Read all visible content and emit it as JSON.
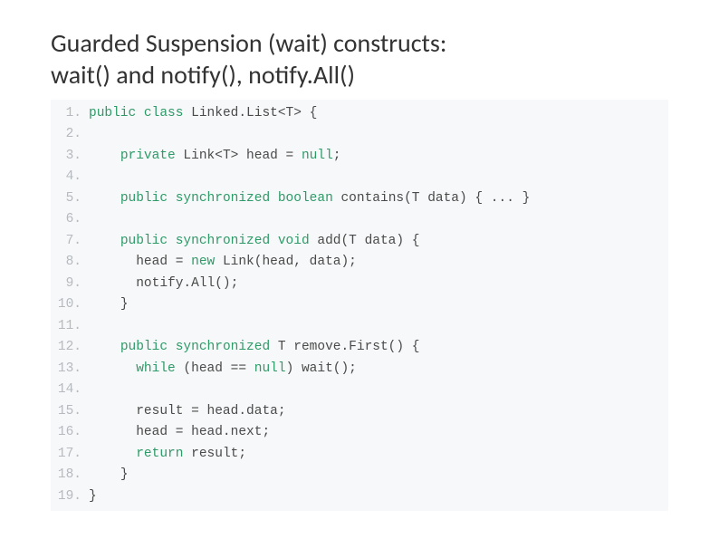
{
  "title_line1": "Guarded Suspension (wait) constructs:",
  "title_line2": "wait() and notify(), notify.All()",
  "code": {
    "lines": [
      {
        "num": "1.",
        "indent": "",
        "tokens": [
          {
            "c": "kw",
            "t": "public"
          },
          {
            "c": "pl",
            "t": " "
          },
          {
            "c": "kw",
            "t": "class"
          },
          {
            "c": "pl",
            "t": " Linked.List<T> {"
          }
        ]
      },
      {
        "num": "2.",
        "indent": "",
        "tokens": []
      },
      {
        "num": "3.",
        "indent": "    ",
        "tokens": [
          {
            "c": "kw",
            "t": "private"
          },
          {
            "c": "pl",
            "t": " Link<T> head = "
          },
          {
            "c": "kw",
            "t": "null"
          },
          {
            "c": "pl",
            "t": ";"
          }
        ]
      },
      {
        "num": "4.",
        "indent": "",
        "tokens": []
      },
      {
        "num": "5.",
        "indent": "    ",
        "tokens": [
          {
            "c": "kw",
            "t": "public"
          },
          {
            "c": "pl",
            "t": " "
          },
          {
            "c": "kw",
            "t": "synchronized"
          },
          {
            "c": "pl",
            "t": " "
          },
          {
            "c": "kw",
            "t": "boolean"
          },
          {
            "c": "pl",
            "t": " contains(T data) { ... }"
          }
        ]
      },
      {
        "num": "6.",
        "indent": "",
        "tokens": []
      },
      {
        "num": "7.",
        "indent": "    ",
        "tokens": [
          {
            "c": "kw",
            "t": "public"
          },
          {
            "c": "pl",
            "t": " "
          },
          {
            "c": "kw",
            "t": "synchronized"
          },
          {
            "c": "pl",
            "t": " "
          },
          {
            "c": "kw",
            "t": "void"
          },
          {
            "c": "pl",
            "t": " add(T data) {"
          }
        ]
      },
      {
        "num": "8.",
        "indent": "      ",
        "tokens": [
          {
            "c": "pl",
            "t": "head = "
          },
          {
            "c": "kw",
            "t": "new"
          },
          {
            "c": "pl",
            "t": " Link(head, data);"
          }
        ]
      },
      {
        "num": "9.",
        "indent": "      ",
        "tokens": [
          {
            "c": "pl",
            "t": "notify.All();"
          }
        ]
      },
      {
        "num": "10.",
        "indent": "    ",
        "tokens": [
          {
            "c": "pl",
            "t": "}"
          }
        ]
      },
      {
        "num": "11.",
        "indent": "",
        "tokens": []
      },
      {
        "num": "12.",
        "indent": "    ",
        "tokens": [
          {
            "c": "kw",
            "t": "public"
          },
          {
            "c": "pl",
            "t": " "
          },
          {
            "c": "kw",
            "t": "synchronized"
          },
          {
            "c": "pl",
            "t": " T remove.First() {"
          }
        ]
      },
      {
        "num": "13.",
        "indent": "      ",
        "tokens": [
          {
            "c": "kw",
            "t": "while"
          },
          {
            "c": "pl",
            "t": " (head == "
          },
          {
            "c": "kw",
            "t": "null"
          },
          {
            "c": "pl",
            "t": ") wait();"
          }
        ]
      },
      {
        "num": "14.",
        "indent": "",
        "tokens": []
      },
      {
        "num": "15.",
        "indent": "      ",
        "tokens": [
          {
            "c": "pl",
            "t": "result = head.data;"
          }
        ]
      },
      {
        "num": "16.",
        "indent": "      ",
        "tokens": [
          {
            "c": "pl",
            "t": "head = head.next;"
          }
        ]
      },
      {
        "num": "17.",
        "indent": "      ",
        "tokens": [
          {
            "c": "kw",
            "t": "return"
          },
          {
            "c": "pl",
            "t": " result;"
          }
        ]
      },
      {
        "num": "18.",
        "indent": "    ",
        "tokens": [
          {
            "c": "pl",
            "t": "}"
          }
        ]
      },
      {
        "num": "19.",
        "indent": "",
        "tokens": [
          {
            "c": "pl",
            "t": "}"
          }
        ]
      }
    ]
  }
}
